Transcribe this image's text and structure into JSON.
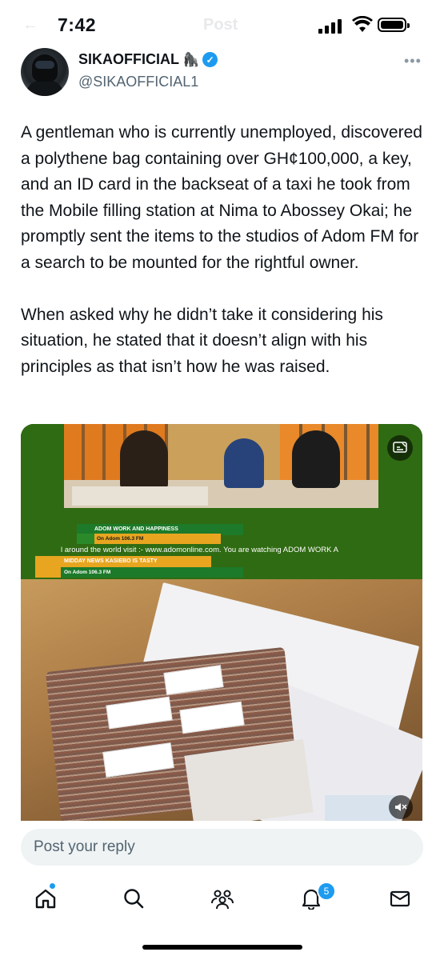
{
  "status_bar": {
    "time": "7:42",
    "ghost_title": "Post"
  },
  "tweet": {
    "display_name": "SIKAOFFICIAL",
    "name_emoji": "🦍",
    "handle": "@SIKAOFFICIAL1",
    "more_label": "•••",
    "text": "A gentleman who is currently unemployed, discovered a polythene bag containing over GH¢100,000, a key, and an ID card in the backseat of a taxi he took from the Mobile filling station at Nima to Abossey Okai; he promptly sent the items to the studios of Adom FM for a search to be mounted for the rightful owner.\n\nWhen asked why he didn’t take it considering his situation, he stated that it doesn’t align with his principles as that isn’t how he was raised."
  },
  "media": {
    "tv_lower_third_1": "ADOM WORK AND HAPPINESS",
    "tv_lower_third_2": "On Adom 106.3 FM",
    "tv_crawl": "l around the world visit :- www.adomonline.com.    You are watching ADOM WORK A",
    "tv_bottom_1": "MIDDAY NEWS KASIEBO IS TASTY",
    "tv_bottom_2": "On Adom 106.3 FM",
    "captions_icon": "closed-captions-icon",
    "mute_icon": "speaker-muted-icon"
  },
  "reply": {
    "placeholder": "Post your reply"
  },
  "tabbar": {
    "items": [
      "home-icon",
      "search-icon",
      "communities-icon",
      "notifications-icon",
      "messages-icon"
    ],
    "notification_count": "5"
  },
  "colors": {
    "accent": "#1d9bf0",
    "text": "#0f1419",
    "secondary": "#536471"
  }
}
